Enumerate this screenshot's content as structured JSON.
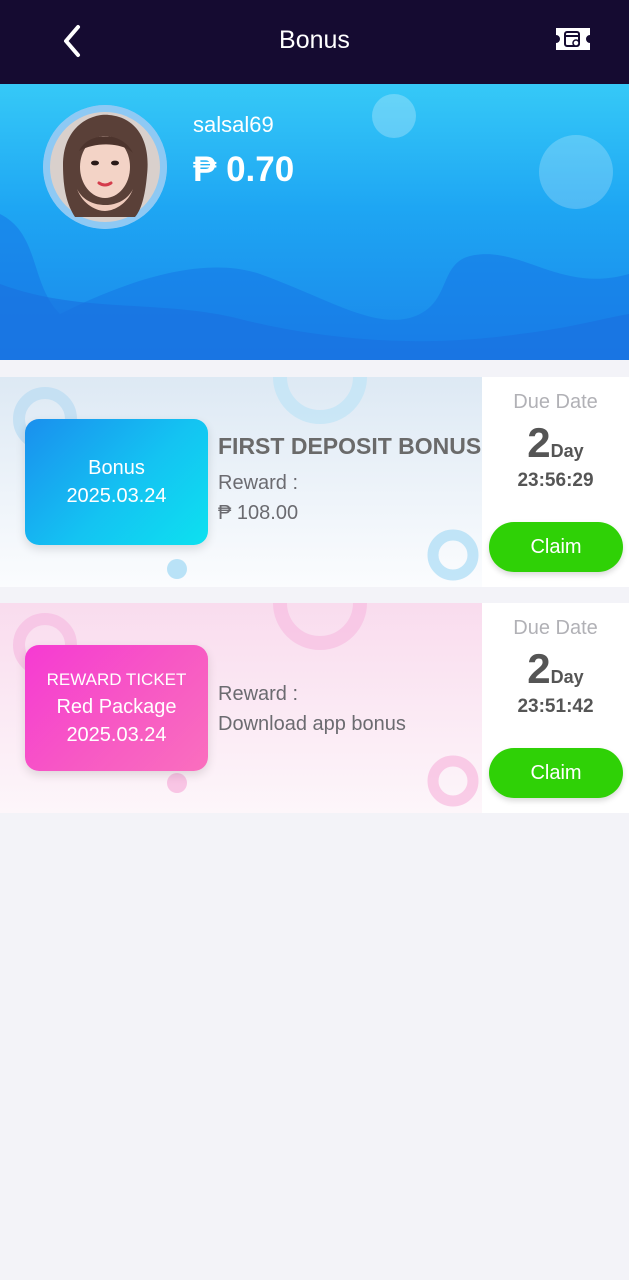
{
  "header": {
    "title": "Bonus",
    "back_icon": "chevron-left-icon",
    "ticket_icon": "ticket-icon"
  },
  "profile": {
    "username": "salsal69",
    "balance": "₱ 0.70"
  },
  "bonuses": [
    {
      "tag_lines": [
        "Bonus",
        "2025.03.24"
      ],
      "title": "FIRST DEPOSIT BONUS",
      "reward_label": "Reward :",
      "reward_value": "₱ 108.00",
      "due_label": "Due Date",
      "due_days": "2",
      "due_unit": "Day",
      "due_time": "23:56:29",
      "claim_label": "Claim"
    },
    {
      "tag_lines": [
        "REWARD TICKET",
        "Red Package",
        "2025.03.24"
      ],
      "reward_label": "Reward :",
      "reward_value": "Download app bonus",
      "due_label": "Due Date",
      "due_days": "2",
      "due_unit": "Day",
      "due_time": "23:51:42",
      "claim_label": "Claim"
    }
  ],
  "colors": {
    "header_bg": "#150b31",
    "claim_green": "#2fd106",
    "banner_blue": "#1ea6f3",
    "tag_pink": "#f759c4"
  }
}
